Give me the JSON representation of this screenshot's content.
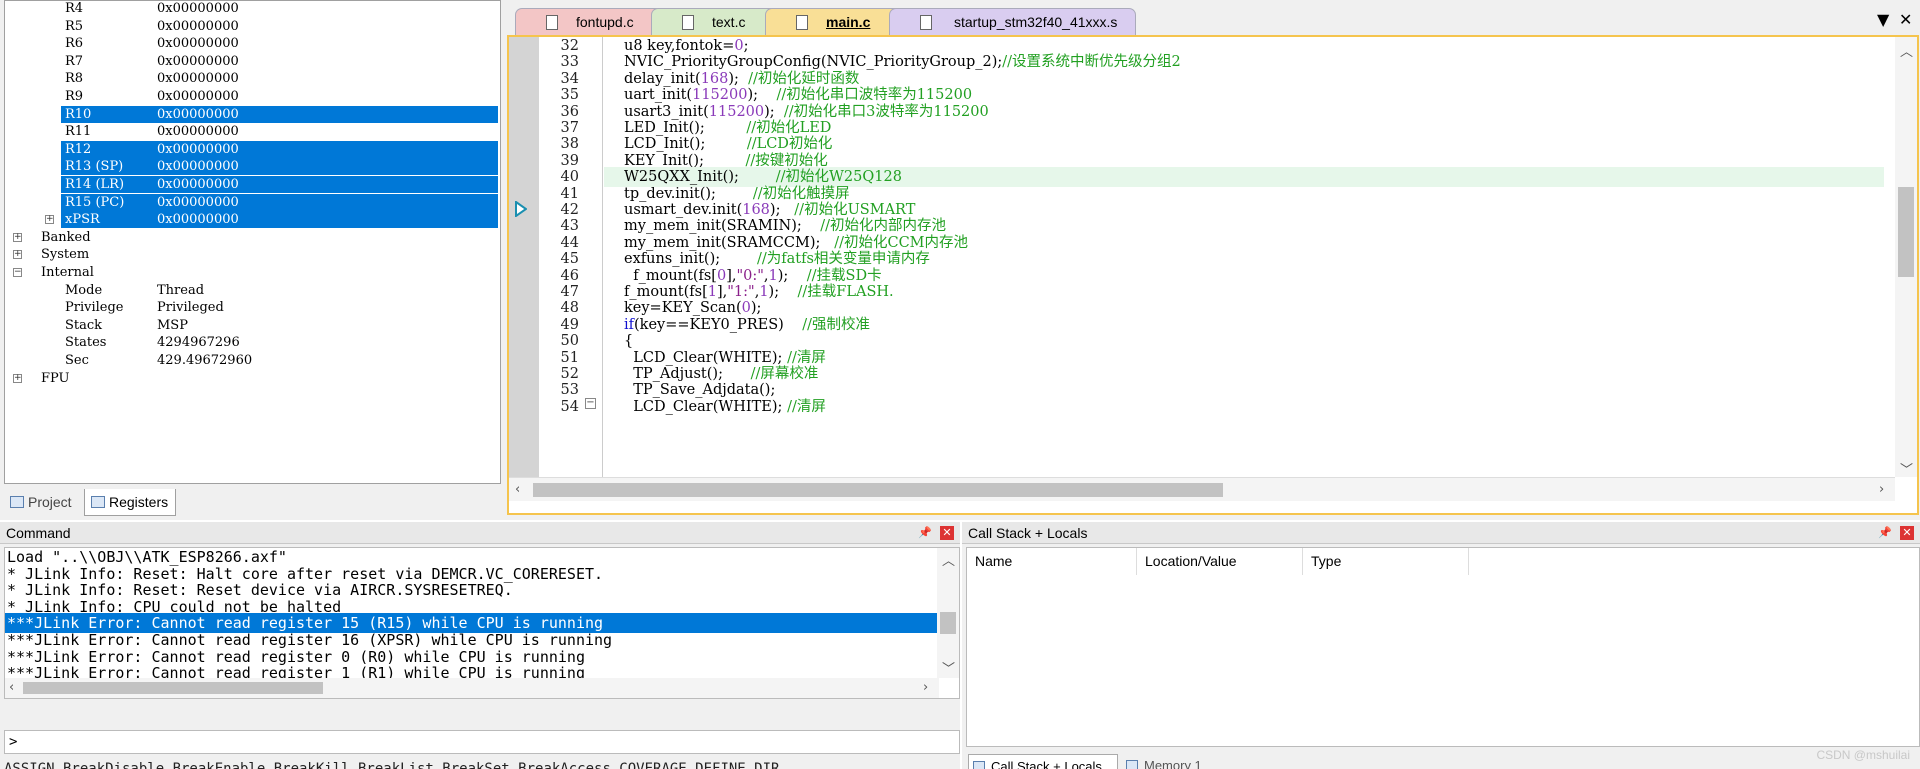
{
  "registers": {
    "rows": [
      {
        "name": "R4",
        "value": "0x00000000",
        "selected": false
      },
      {
        "name": "R5",
        "value": "0x00000000",
        "selected": false
      },
      {
        "name": "R6",
        "value": "0x00000000",
        "selected": false
      },
      {
        "name": "R7",
        "value": "0x00000000",
        "selected": false
      },
      {
        "name": "R8",
        "value": "0x00000000",
        "selected": false
      },
      {
        "name": "R9",
        "value": "0x00000000",
        "selected": false
      },
      {
        "name": "R10",
        "value": "0x00000000",
        "selected": true
      },
      {
        "name": "R11",
        "value": "0x00000000",
        "selected": false
      },
      {
        "name": "R12",
        "value": "0x00000000",
        "selected": true
      },
      {
        "name": "R13 (SP)",
        "value": "0x00000000",
        "selected": true
      },
      {
        "name": "R14 (LR)",
        "value": "0x00000000",
        "selected": true
      },
      {
        "name": "R15 (PC)",
        "value": "0x00000000",
        "selected": true
      },
      {
        "name": "xPSR",
        "value": "0x00000000",
        "selected": true,
        "expand": "+"
      }
    ],
    "groups": [
      "Banked",
      "System",
      "Internal"
    ],
    "internal": [
      {
        "name": "Mode",
        "value": "Thread"
      },
      {
        "name": "Privilege",
        "value": "Privileged"
      },
      {
        "name": "Stack",
        "value": "MSP"
      },
      {
        "name": "States",
        "value": "4294967296"
      },
      {
        "name": "Sec",
        "value": "429.49672960"
      }
    ],
    "fpu": "FPU",
    "tabs": {
      "project": "Project",
      "registers": "Registers"
    }
  },
  "editor": {
    "tabs": [
      "fontupd.c",
      "text.c",
      "main.c",
      "startup_stm32f40_41xxx.s"
    ],
    "active_tab": "main.c",
    "tab_colors": [
      "#f3c6c6",
      "#d7eac9",
      "#f9df96",
      "#d9cdf0"
    ],
    "tab_controls": {
      "dropdown": "▼",
      "close": "✕"
    },
    "current_line": 40,
    "lines": [
      {
        "n": "32",
        "code": "u8 key,fontok=0;"
      },
      {
        "n": "33",
        "code": "NVIC_PriorityGroupConfig(NVIC_PriorityGroup_2);//设置系统中断优先级分组2"
      },
      {
        "n": "34",
        "code": "delay_init(168);  //初始化延时函数"
      },
      {
        "n": "35",
        "code": "uart_init(115200);    //初始化串口波特率为115200"
      },
      {
        "n": "36",
        "code": "usart3_init(115200);  //初始化串口3波特率为115200"
      },
      {
        "n": "37",
        "code": "LED_Init();         //初始化LED"
      },
      {
        "n": "38",
        "code": "LCD_Init();         //LCD初始化"
      },
      {
        "n": "39",
        "code": "KEY_Init();         //按键初始化"
      },
      {
        "n": "40",
        "code": "W25QXX_Init();        //初始化W25Q128"
      },
      {
        "n": "41",
        "code": "tp_dev.init();        //初始化触摸屏"
      },
      {
        "n": "42",
        "code": "usmart_dev.init(168);   //初始化USMART"
      },
      {
        "n": "43",
        "code": "my_mem_init(SRAMIN);    //初始化内部内存池"
      },
      {
        "n": "44",
        "code": "my_mem_init(SRAMCCM);   //初始化CCM内存池"
      },
      {
        "n": "45",
        "code": "exfuns_init();        //为fatfs相关变量申请内存"
      },
      {
        "n": "46",
        "code": "  f_mount(fs[0],\"0:\",1);    //挂载SD卡"
      },
      {
        "n": "47",
        "code": "f_mount(fs[1],\"1:\",1);    //挂载FLASH."
      },
      {
        "n": "48",
        "code": "key=KEY_Scan(0);"
      },
      {
        "n": "49",
        "code": "if(key==KEY0_PRES)    //强制校准"
      },
      {
        "n": "50",
        "code": "{"
      },
      {
        "n": "51",
        "code": "  LCD_Clear(WHITE); //清屏"
      },
      {
        "n": "52",
        "code": "  TP_Adjust();      //屏幕校准"
      },
      {
        "n": "53",
        "code": "  TP_Save_Adjdata();"
      },
      {
        "n": "54",
        "code": "  LCD_Clear(WHITE); //清屏"
      }
    ]
  },
  "command": {
    "title": "Command",
    "lines": [
      {
        "text": "Load \"..\\\\OBJ\\\\ATK_ESP8266.axf\"",
        "selected": false
      },
      {
        "text": "* JLink Info: Reset: Halt core after reset via DEMCR.VC_CORERESET.",
        "selected": false
      },
      {
        "text": "* JLink Info: Reset: Reset device via AIRCR.SYSRESETREQ.",
        "selected": false
      },
      {
        "text": "* JLink Info: CPU could not be halted",
        "selected": false
      },
      {
        "text": "***JLink Error: Cannot read register 15 (R15) while CPU is running",
        "selected": true
      },
      {
        "text": "***JLink Error: Cannot read register 16 (XPSR) while CPU is running",
        "selected": false
      },
      {
        "text": "***JLink Error: Cannot read register 0 (R0) while CPU is running",
        "selected": false
      },
      {
        "text": "***JLink Error: Cannot read register 1 (R1) while CPU is running",
        "selected": false
      }
    ],
    "prompt": ">",
    "hint": "ASSIGN BreakDisable BreakEnable BreakKill BreakList BreakSet BreakAccess COVERAGE DEFINE DIR"
  },
  "callstack": {
    "title": "Call Stack + Locals",
    "columns": [
      "Name",
      "Location/Value",
      "Type"
    ],
    "tabs": [
      "Call Stack + Locals",
      "Memory 1"
    ]
  },
  "panel_buttons": {
    "pin": "📌",
    "close": "✕"
  },
  "watermark": "CSDN @mshuilai"
}
